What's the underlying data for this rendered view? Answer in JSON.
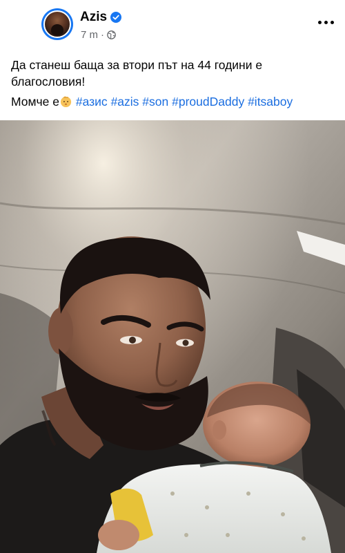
{
  "post": {
    "author_name": "Azis",
    "time": "7 m",
    "separator": "·",
    "verified_icon": "verified-badge-icon",
    "privacy_icon": "globe-icon",
    "more_icon": "more-options-icon",
    "caption_line1": "Да станеш баща за втори път на 44 години е благословия!",
    "caption_line2_text": "Момче е",
    "caption_emoji": "baby-emoji",
    "hashtags": [
      "#азис",
      "#azis",
      "#son",
      "#proudDaddy",
      "#itsaboy"
    ],
    "colors": {
      "link": "#1b6ee0",
      "verified": "#1877f2",
      "meta": "#65676b"
    }
  }
}
